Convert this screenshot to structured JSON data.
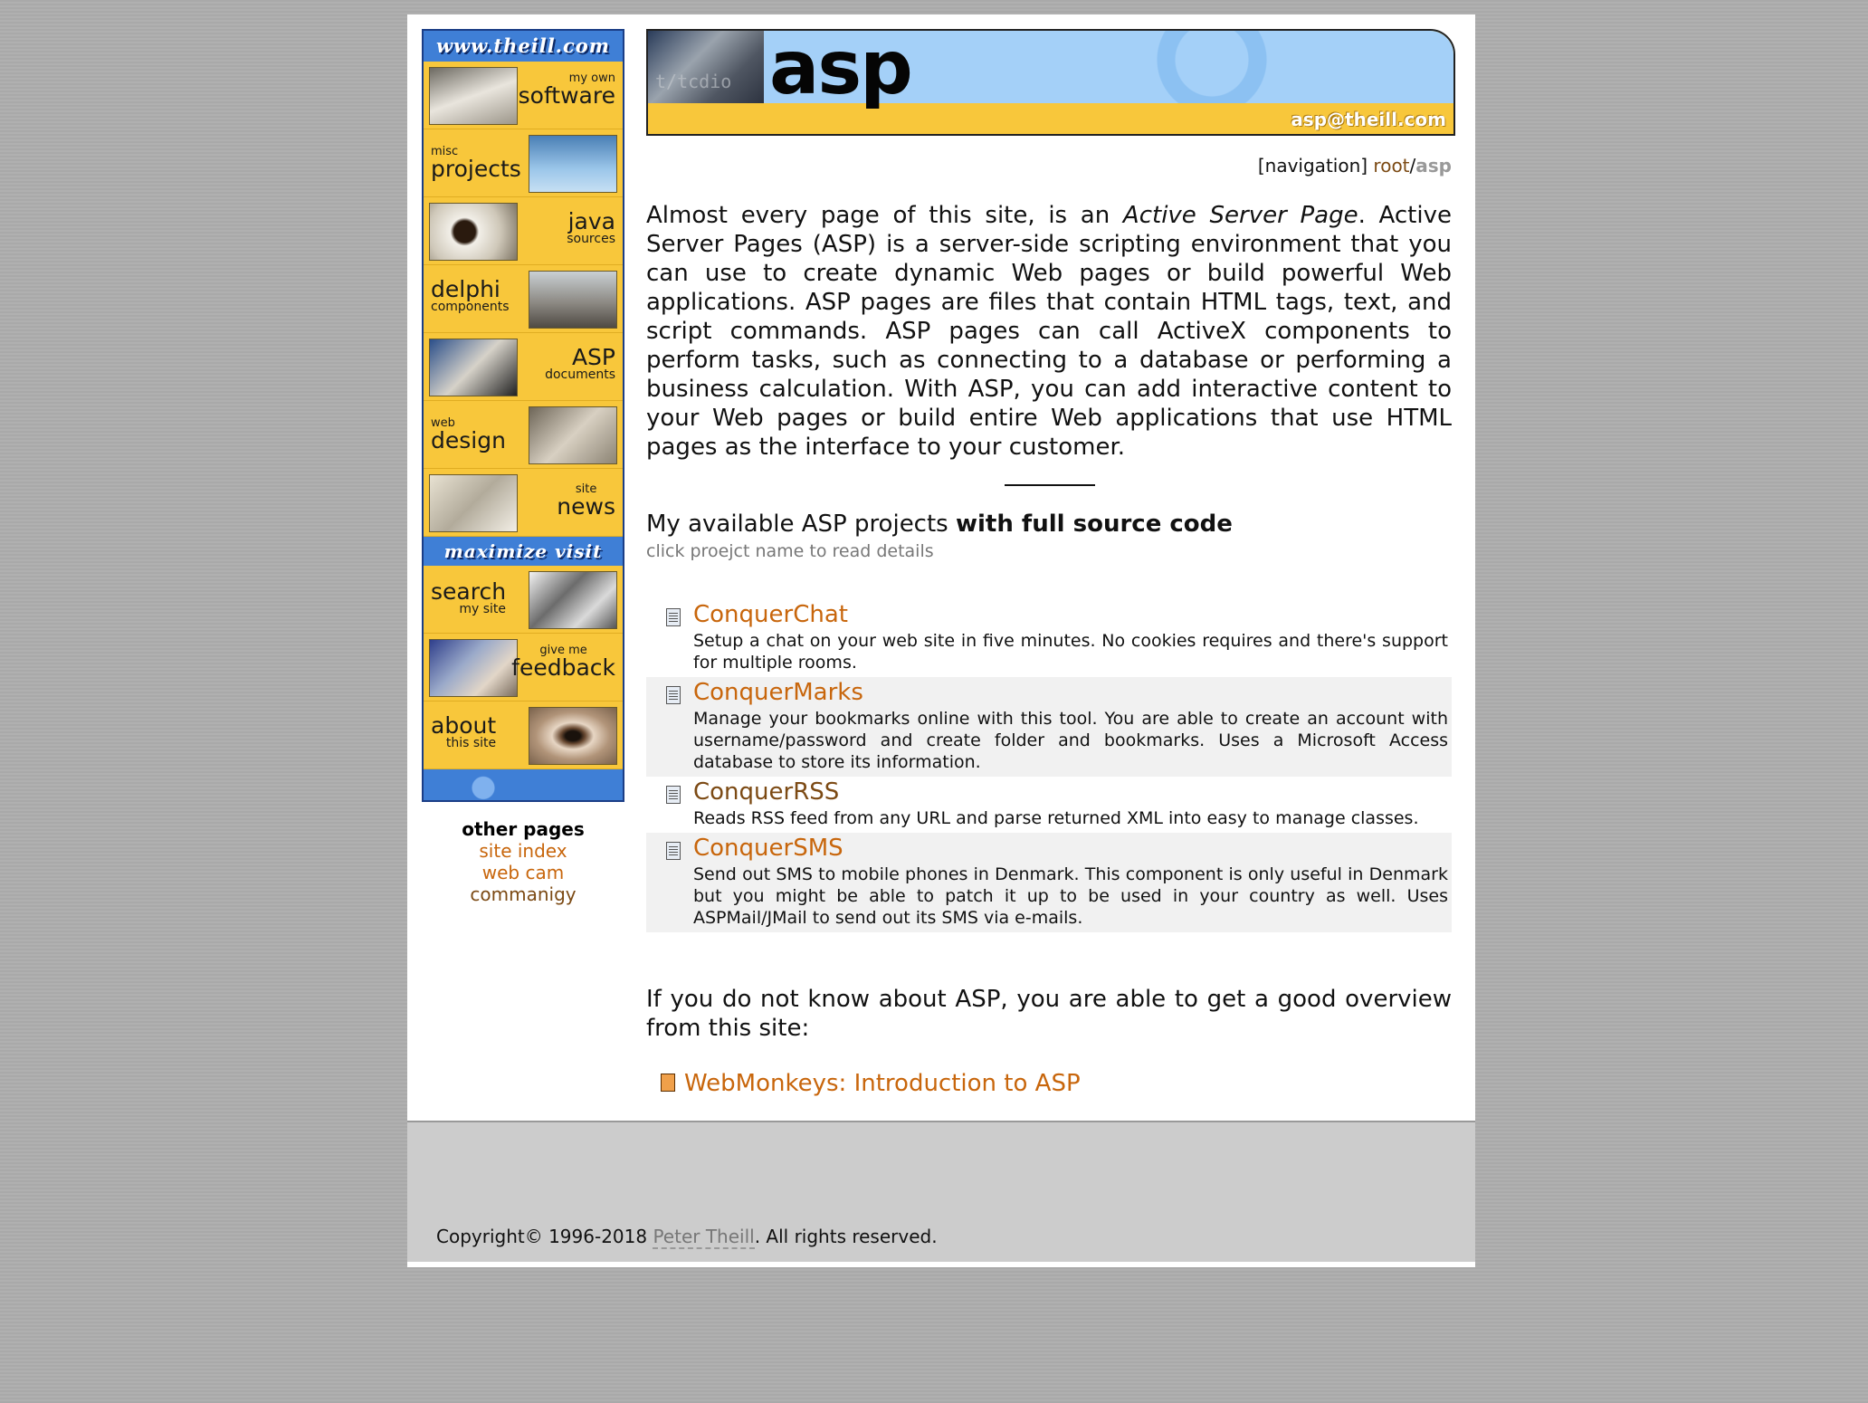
{
  "sidebar": {
    "brand": "www.theill.com",
    "items": [
      {
        "small": "my own",
        "big": "software",
        "sub": ""
      },
      {
        "small": "misc",
        "big": "projects",
        "sub": ""
      },
      {
        "small": "",
        "big": "java",
        "sub": "sources"
      },
      {
        "small": "",
        "big": "delphi",
        "sub": "components"
      },
      {
        "small": "",
        "big": "ASP",
        "sub": "documents"
      },
      {
        "small": "web",
        "big": "design",
        "sub": ""
      },
      {
        "small": "site",
        "big": "news",
        "sub": ""
      }
    ],
    "banner": "maximize visit",
    "items2": [
      {
        "small": "",
        "big": "search",
        "sub": "my site"
      },
      {
        "small": "give me",
        "big": "feedback",
        "sub": ""
      },
      {
        "small": "",
        "big": "about",
        "sub": "this site"
      }
    ]
  },
  "other_pages": {
    "heading": "other pages",
    "links": [
      "site index",
      "web cam",
      "commanigy"
    ]
  },
  "header": {
    "photo_text": "t/tcdio",
    "title": "asp",
    "email": "asp@theill.com"
  },
  "breadcrumb": {
    "prefix": "[navigation]",
    "root": "root",
    "sep": "/",
    "current": "asp"
  },
  "intro": {
    "part1": "Almost every page of this site, is an ",
    "italic": "Active Server Page",
    "part2": ". Active Server Pages (ASP) is a server-side scripting environment that you can use to create dynamic Web pages or build powerful Web applications. ASP pages are files that contain HTML tags, text, and script commands. ASP pages can call ActiveX components to perform tasks, such as connecting to a database or performing a business calculation. With ASP, you can add interactive content to your Web pages or build entire Web applications that use HTML pages as the interface to your customer."
  },
  "projects_section": {
    "heading": "My available ASP projects ",
    "heading_bold": "with full source code",
    "hint": "click proejct name to read details",
    "items": [
      {
        "name": "ConquerChat",
        "desc": "Setup a chat on your web site in five minutes. No cookies requires and there's support for multiple rooms."
      },
      {
        "name": "ConquerMarks",
        "desc": "Manage your bookmarks online with this tool. You are able to create an account with username/password and create folder and bookmarks. Uses a Microsoft Access database to store its information."
      },
      {
        "name": "ConquerRSS",
        "desc": "Reads RSS feed from any URL and parse returned XML into easy to manage classes."
      },
      {
        "name": "ConquerSMS",
        "desc": "Send out SMS to mobile phones in Denmark. This component is only useful in Denmark but you might be able to patch it up to be used in your country as well. Uses ASPMail/JMail to send out its SMS via e-mails."
      }
    ]
  },
  "overview": {
    "text": "If you do not know about ASP, you are able to get a good overview from this site:",
    "link": "WebMonkeys: Introduction to ASP"
  },
  "footer": {
    "prefix": "Copyright© 1996-2018 ",
    "author": "Peter Theill",
    "suffix": ". All rights reserved."
  },
  "colors": {
    "link": "#c8660c",
    "visited_link": "#7c4a14",
    "nav_yellow": "#f8c73b",
    "nav_blue": "#3f7fd6"
  }
}
